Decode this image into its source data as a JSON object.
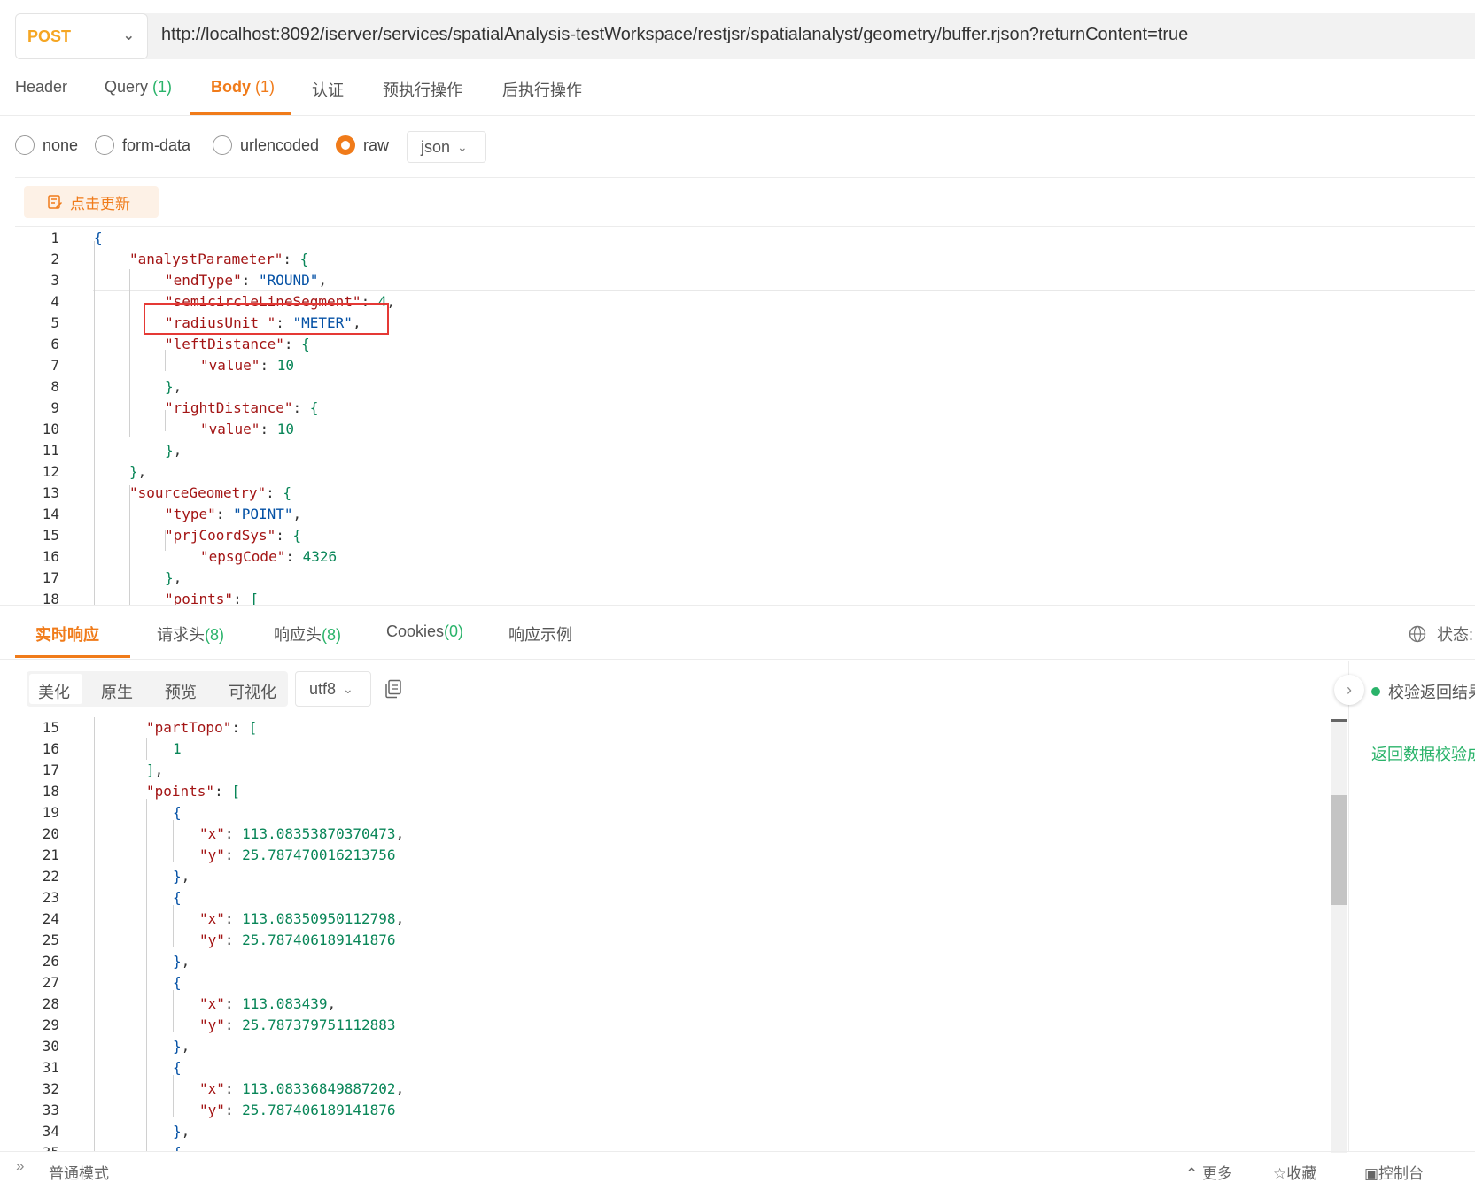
{
  "request": {
    "method": "POST",
    "url": "http://localhost:8092/iserver/services/spatialAnalysis-testWorkspace/restjsr/spatialanalyst/geometry/buffer.rjson?returnContent=true"
  },
  "req_tabs": [
    {
      "label": "Header",
      "count": ""
    },
    {
      "label": "Query",
      "count": "(1)"
    },
    {
      "label": "Body",
      "count": "(1)"
    },
    {
      "label": "认证",
      "count": ""
    },
    {
      "label": "预执行操作",
      "count": ""
    },
    {
      "label": "后执行操作",
      "count": ""
    }
  ],
  "body_types": [
    "none",
    "form-data",
    "urlencoded",
    "raw"
  ],
  "body_format": "json",
  "update_button": "点击更新",
  "resp_tabs": [
    {
      "label": "实时响应",
      "count": ""
    },
    {
      "label": "请求头",
      "count": "(8)"
    },
    {
      "label": "响应头",
      "count": "(8)"
    },
    {
      "label": "Cookies",
      "count": "(0)"
    },
    {
      "label": "响应示例",
      "count": ""
    }
  ],
  "status_label": "状态:",
  "view_modes": [
    "美化",
    "原生",
    "预览",
    "可视化"
  ],
  "encoding": "utf8",
  "validate_label": "校验返回结果",
  "validate_msg": "返回数据校验成",
  "footer": {
    "mode": "普通模式",
    "more": "更多",
    "favorite": "收藏",
    "console": "控制台"
  },
  "colors": {
    "accent": "#f07b1a",
    "method": "#f5a623",
    "count_green": "#2ab36a",
    "json_key": "#a31515",
    "json_string": "#0451a5",
    "json_number": "#098658",
    "highlight_box": "#e53935"
  }
}
